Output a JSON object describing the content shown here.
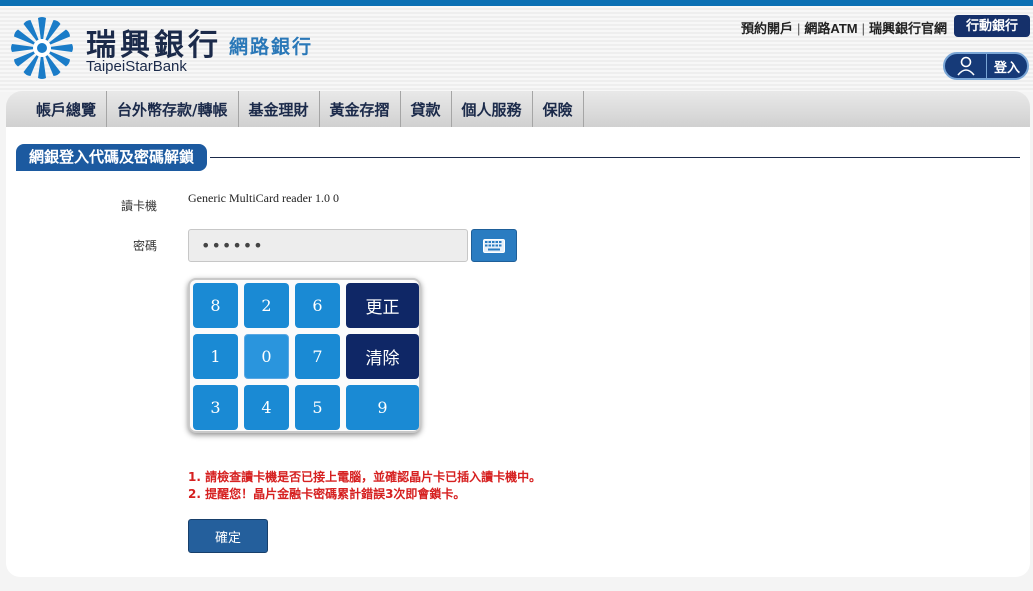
{
  "brand": {
    "name": "瑞興銀行",
    "name_en": "TaipeiStarBank",
    "subtitle": "網路銀行"
  },
  "top_links": {
    "open_account": "預約開戶",
    "atm": "網路ATM",
    "official_site": "瑞興銀行官網",
    "separator": "|",
    "mobile_bank": "行動銀行",
    "login": "登入"
  },
  "nav": {
    "items": [
      "帳戶總覽",
      "台外幣存款/轉帳",
      "基金理財",
      "黃金存摺",
      "貸款",
      "個人服務",
      "保險"
    ]
  },
  "section": {
    "title": "網銀登入代碼及密碼解鎖"
  },
  "form": {
    "reader_label": "讀卡機",
    "reader_value": "Generic MultiCard reader 1.0 0",
    "password_label": "密碼",
    "password_value": "••••••"
  },
  "keypad": {
    "row1": [
      "8",
      "2",
      "6"
    ],
    "row2": [
      "1",
      "0",
      "7"
    ],
    "row3": [
      "3",
      "4",
      "5"
    ],
    "wide_key": "9",
    "correct_label": "更正",
    "clear_label": "清除"
  },
  "notes": {
    "line1": "1. 請檢查讀卡機是否已接上電腦，並確認晶片卡已插入讀卡機中。",
    "line2": "2. 提醒您！晶片金融卡密碼累計錯誤3次即會鎖卡。"
  },
  "confirm_label": "確定",
  "colors": {
    "brand_blue": "#1c5aa0",
    "key_blue": "#1a8ad4",
    "key_dark": "#0f2766",
    "warning_red": "#d62020"
  }
}
